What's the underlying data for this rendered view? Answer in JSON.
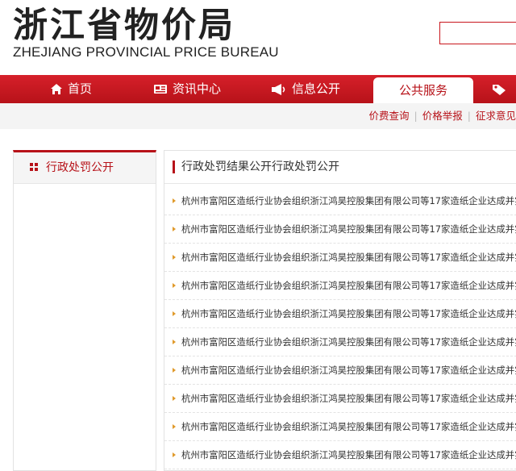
{
  "header": {
    "logo_cn": "浙江省物价局",
    "logo_en": "ZHEJIANG PROVINCIAL PRICE BUREAU"
  },
  "nav": {
    "items": [
      {
        "label": "首页",
        "icon": "home-icon"
      },
      {
        "label": "资讯中心",
        "icon": "newspaper-icon"
      },
      {
        "label": "信息公开",
        "icon": "megaphone-icon"
      },
      {
        "label": "公共服务",
        "icon": ""
      },
      {
        "label": "",
        "icon": "tag-icon"
      }
    ],
    "active_index": 3
  },
  "subnav": {
    "links": [
      "价费查询",
      "价格举报",
      "征求意见"
    ]
  },
  "sidebar": {
    "items": [
      {
        "label": "行政处罚公开",
        "icon": "grid-icon"
      }
    ]
  },
  "main": {
    "title": "行政处罚结果公开行政处罚公开",
    "rows": [
      "杭州市富阳区造纸行业协会组织浙江鸿昊控股集团有限公司等17家造纸企业达成并实施...",
      "杭州市富阳区造纸行业协会组织浙江鸿昊控股集团有限公司等17家造纸企业达成并实施...",
      "杭州市富阳区造纸行业协会组织浙江鸿昊控股集团有限公司等17家造纸企业达成并实施...",
      "杭州市富阳区造纸行业协会组织浙江鸿昊控股集团有限公司等17家造纸企业达成并实施...",
      "杭州市富阳区造纸行业协会组织浙江鸿昊控股集团有限公司等17家造纸企业达成并实施...",
      "杭州市富阳区造纸行业协会组织浙江鸿昊控股集团有限公司等17家造纸企业达成并实施...",
      "杭州市富阳区造纸行业协会组织浙江鸿昊控股集团有限公司等17家造纸企业达成并实施...",
      "杭州市富阳区造纸行业协会组织浙江鸿昊控股集团有限公司等17家造纸企业达成并实施...",
      "杭州市富阳区造纸行业协会组织浙江鸿昊控股集团有限公司等17家造纸企业达成并实施...",
      "杭州市富阳区造纸行业协会组织浙江鸿昊控股集团有限公司等17家造纸企业达成并实施..."
    ]
  },
  "colors": {
    "brand_red": "#b71219",
    "bullet_orange": "#e09a2b"
  }
}
